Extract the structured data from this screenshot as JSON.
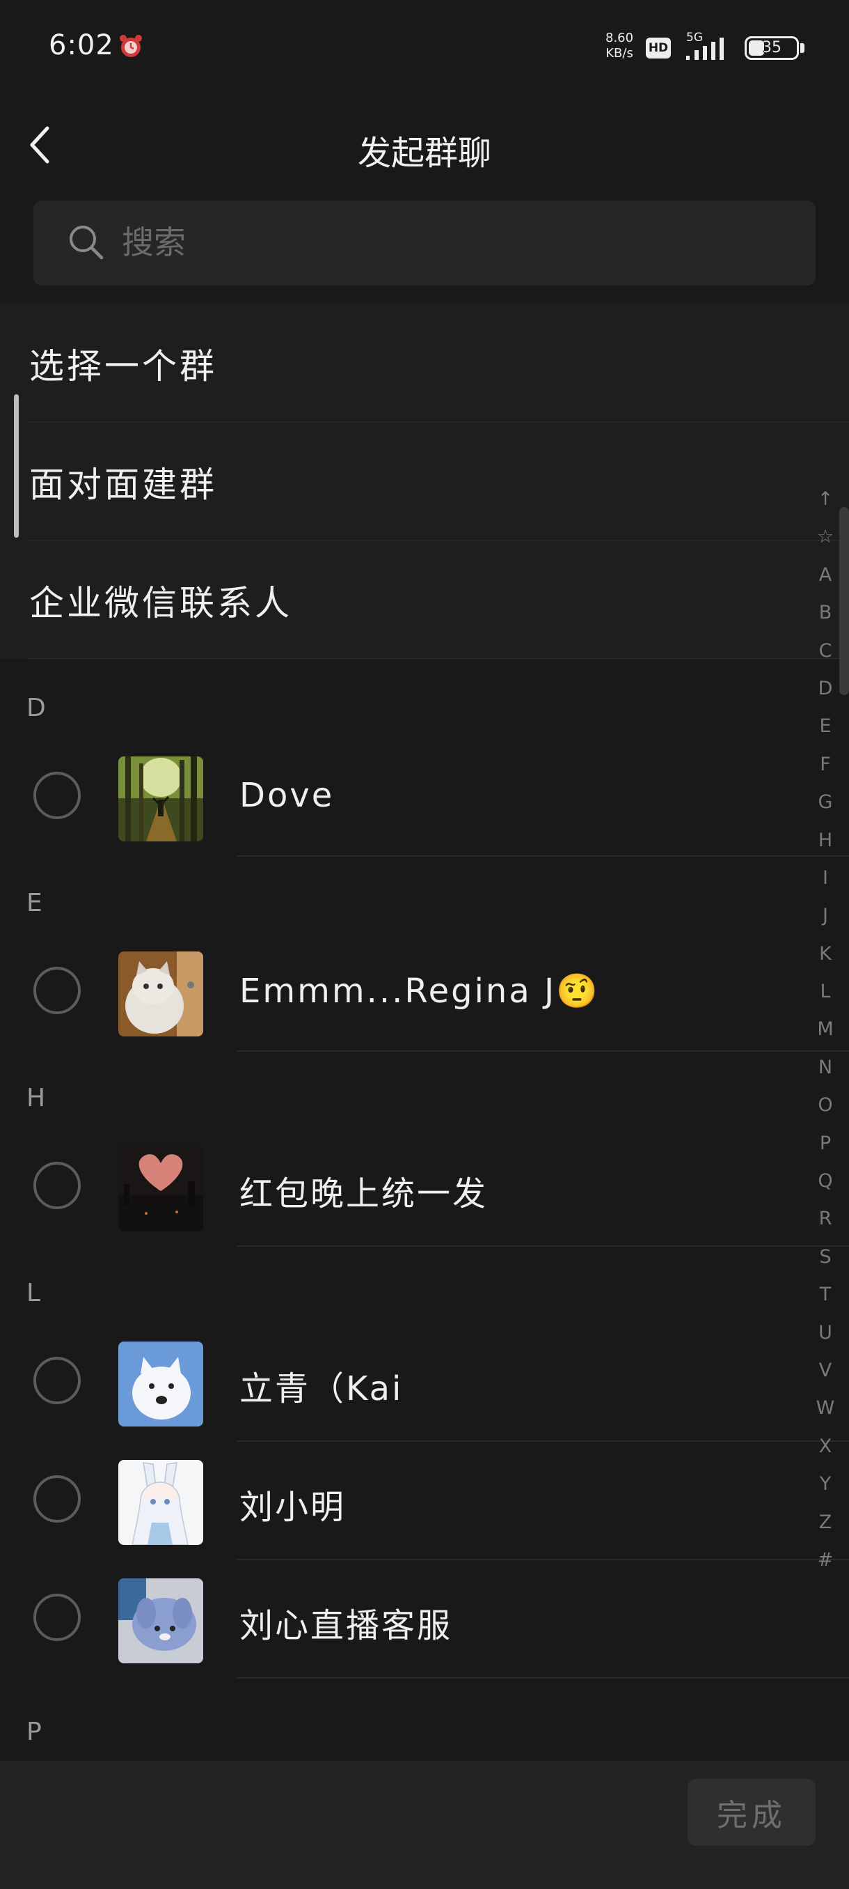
{
  "status_bar": {
    "time": "6:02",
    "net_speed_value": "8.60",
    "net_speed_unit": "KB/s",
    "hd_label": "HD",
    "network_type": "5G",
    "battery_level": "35"
  },
  "nav": {
    "title": "发起群聊"
  },
  "search": {
    "placeholder": "搜索"
  },
  "menu": {
    "items": [
      {
        "label": "选择一个群"
      },
      {
        "label": "面对面建群"
      },
      {
        "label": "企业微信联系人"
      }
    ]
  },
  "contacts": {
    "sections": [
      {
        "letter": "D",
        "items": [
          {
            "name": "Dove",
            "avatar": "forest-photo"
          }
        ]
      },
      {
        "letter": "E",
        "items": [
          {
            "name": "Emmm...Regina J🤨",
            "avatar": "cat-photo"
          }
        ]
      },
      {
        "letter": "H",
        "items": [
          {
            "name": "红包晚上统一发",
            "avatar": "heart-sunset-photo"
          }
        ]
      },
      {
        "letter": "L",
        "items": [
          {
            "name": "立青（Kai",
            "avatar": "white-dog-photo"
          },
          {
            "name": "刘小明",
            "avatar": "anime-bunny-girl"
          },
          {
            "name": "刘心直播客服",
            "avatar": "blue-plush-photo"
          }
        ]
      },
      {
        "letter": "P",
        "items": []
      }
    ]
  },
  "index_bar": {
    "letters": [
      "↑",
      "☆",
      "A",
      "B",
      "C",
      "D",
      "E",
      "F",
      "G",
      "H",
      "I",
      "J",
      "K",
      "L",
      "M",
      "N",
      "O",
      "P",
      "Q",
      "R",
      "S",
      "T",
      "U",
      "V",
      "W",
      "X",
      "Y",
      "Z",
      "#"
    ]
  },
  "footer": {
    "done_label": "完成"
  },
  "colors": {
    "background": "#191919",
    "menu_background": "#1e1e1e",
    "footer_background": "#232323",
    "text": "#efefef",
    "muted_text": "#9a9a9a"
  }
}
